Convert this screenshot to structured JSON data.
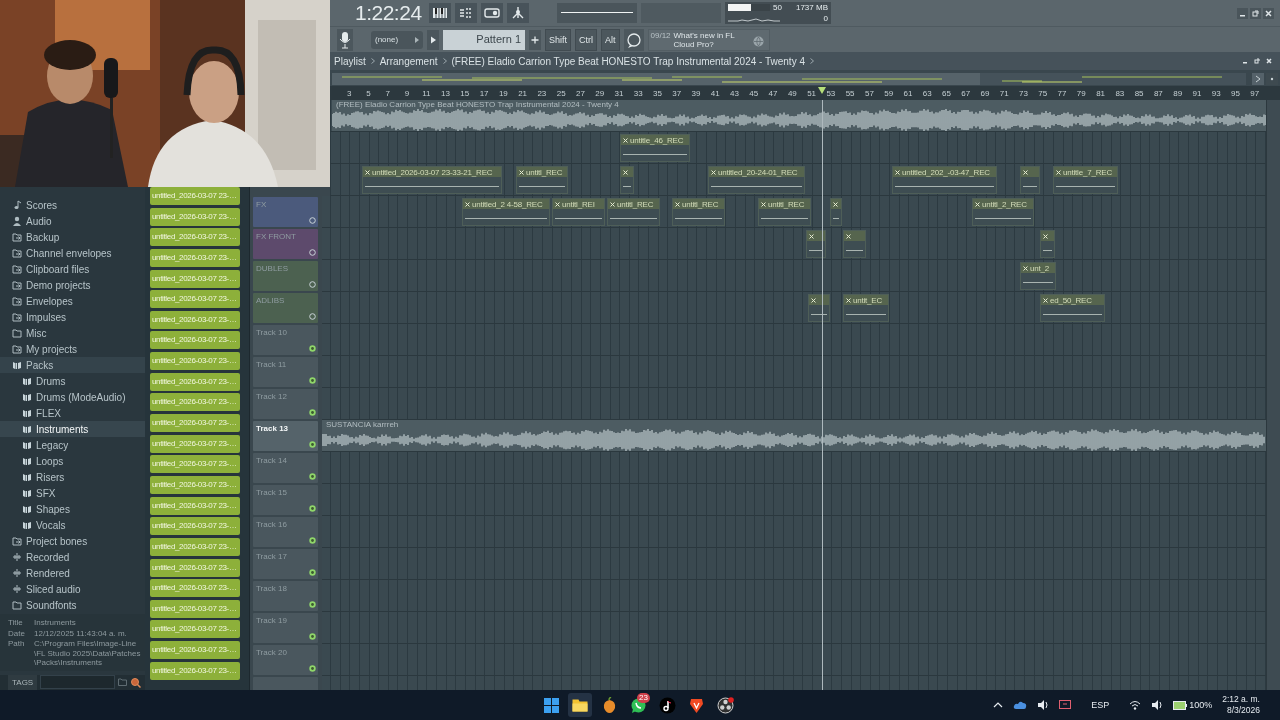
{
  "toolbar": {
    "time": "1:22:24",
    "pattern_mode": "(none)",
    "pattern": "Pattern 1",
    "modifier_keys": [
      "Shift",
      "Ctrl",
      "Alt"
    ],
    "hint_counter": "09/12",
    "hint": "What's new in FL Cloud Pro?",
    "cpu_meter": {
      "level": 0.55
    },
    "cpu": "50",
    "memory": "1737 MB",
    "polyphony": "0"
  },
  "browser": {
    "items": [
      {
        "label": "Scores",
        "kind": "note",
        "selected": false
      },
      {
        "label": "Audio",
        "kind": "person",
        "selected": false
      },
      {
        "label": "Backup",
        "kind": "link",
        "selected": false
      },
      {
        "label": "Channel envelopes",
        "kind": "link",
        "selected": false
      },
      {
        "label": "Clipboard files",
        "kind": "link",
        "selected": false
      },
      {
        "label": "Demo projects",
        "kind": "link",
        "selected": false
      },
      {
        "label": "Envelopes",
        "kind": "link",
        "selected": false
      },
      {
        "label": "Impulses",
        "kind": "link",
        "selected": false
      },
      {
        "label": "Misc",
        "kind": "folder",
        "selected": false
      },
      {
        "label": "My projects",
        "kind": "link",
        "selected": false
      },
      {
        "label": "Packs",
        "kind": "pack",
        "selected": false,
        "expanded": true,
        "children": [
          {
            "label": "Drums",
            "kind": "pack",
            "selected": false
          },
          {
            "label": "Drums (ModeAudio)",
            "kind": "pack",
            "selected": false
          },
          {
            "label": "FLEX",
            "kind": "pack",
            "selected": false
          },
          {
            "label": "Instruments",
            "kind": "pack",
            "selected": true
          },
          {
            "label": "Legacy",
            "kind": "pack",
            "selected": false
          },
          {
            "label": "Loops",
            "kind": "pack",
            "selected": false
          },
          {
            "label": "Risers",
            "kind": "pack",
            "selected": false
          },
          {
            "label": "SFX",
            "kind": "pack",
            "selected": false
          },
          {
            "label": "Shapes",
            "kind": "pack",
            "selected": false
          },
          {
            "label": "Vocals",
            "kind": "pack",
            "selected": false
          }
        ]
      },
      {
        "label": "Project bones",
        "kind": "link",
        "selected": false
      },
      {
        "label": "Recorded",
        "kind": "wave",
        "selected": false
      },
      {
        "label": "Rendered",
        "kind": "wave",
        "selected": false
      },
      {
        "label": "Sliced audio",
        "kind": "wave",
        "selected": false
      },
      {
        "label": "Soundfonts",
        "kind": "folder",
        "selected": false
      }
    ],
    "info": [
      {
        "label": "Title",
        "value": "Instruments"
      },
      {
        "label": "Date",
        "value": "12/12/2025 11:43:04 a. m."
      },
      {
        "label": "Path",
        "value": "C:\\Program Files\\Image-Line\\FL Studio 2025\\Data\\Patches\\Packs\\Instruments"
      }
    ],
    "tags_label": "TAGS"
  },
  "picker": {
    "clips": [
      "untitled_2026-03-07 23-…",
      "untitled_2026-03-07 23-…",
      "untitled_2026-03-07 23-…",
      "untitled_2026-03-07 23-…",
      "untitled_2026-03-07 23-…",
      "untitled_2026-03-07 23-…",
      "untitled_2026-03-07 23-…",
      "untitled_2026-03-07 23-…",
      "untitled_2026-03-07 23-…",
      "untitled_2026-03-07 23-…",
      "untitled_2026-03-07 23-…",
      "untitled_2026-03-07 23-…",
      "untitled_2026-03-07 23-…",
      "untitled_2026-03-07 23-…",
      "untitled_2026-03-07 23-…",
      "untitled_2026-03-07 23-…",
      "untitled_2026-03-07 23-…",
      "untitled_2026-03-07 23-…",
      "untitled_2026-03-07 23-…",
      "untitled_2026-03-07 23-…",
      "untitled_2026-03-07 23-…",
      "untitled_2026-03-07 23-…",
      "untitled_2026-03-07 23-…",
      "untitled_2026-03-07 23-…"
    ]
  },
  "playlist": {
    "title": "Playlist",
    "crumbs": [
      "Arrangement",
      "(FREE) Eladio Carrion Type Beat  HONESTO  Trap Instrumental 2024 - Twenty 4"
    ],
    "song_position": {
      "level": 0.53
    },
    "ruler": [
      "3",
      "5",
      "7",
      "9",
      "11",
      "13",
      "15",
      "17",
      "19",
      "21",
      "23",
      "25",
      "27",
      "29",
      "31",
      "33",
      "35",
      "37",
      "39",
      "41",
      "43",
      "45",
      "47",
      "49",
      "51",
      "53",
      "55",
      "57",
      "59",
      "61",
      "63",
      "65",
      "67",
      "69",
      "71",
      "73",
      "75",
      "77",
      "79",
      "81",
      "83",
      "85",
      "87",
      "89",
      "91",
      "93",
      "95",
      "97"
    ],
    "tracks": [
      {
        "clips": [
          {
            "kind": "waveform",
            "label": "(FREE) Eladio Carrion Type Beat  HONESTO  Trap Instrumental 2024 - Twenty 4"
          }
        ]
      },
      {
        "clips": [
          {
            "kind": "recording",
            "label": "untitle_46_REC"
          }
        ]
      },
      {
        "clips": [
          {
            "kind": "recording",
            "label": "untitled_2026-03-07 23-33-21_REC"
          },
          {
            "kind": "recording",
            "label": "untitl_REC"
          },
          {
            "kind": "recording"
          },
          {
            "kind": "recording",
            "label": "untitled_20-24-01_REC"
          },
          {
            "kind": "recording",
            "label": "untitled_202_-03-47_REC"
          },
          {
            "kind": "recording"
          },
          {
            "kind": "recording",
            "label": "untitle_7_REC"
          }
        ]
      },
      {
        "name": "FX",
        "color": "#4b5a7c",
        "selected": false,
        "clips": [
          {
            "kind": "recording",
            "label": "untitled_2 4-58_REC"
          },
          {
            "kind": "recording",
            "label": "untitl_REI"
          },
          {
            "kind": "recording",
            "label": "untitl_REC"
          },
          {
            "kind": "recording",
            "label": "untitl_REC"
          },
          {
            "kind": "recording",
            "label": "untitl_REC"
          },
          {
            "kind": "recording"
          },
          {
            "kind": "recording",
            "label": "untitl_2_REC"
          }
        ]
      },
      {
        "name": "FX FRONT",
        "color": "#5d4a6c",
        "selected": false,
        "clips": [
          {
            "kind": "recording"
          },
          {
            "kind": "recording"
          },
          {
            "kind": "recording"
          }
        ]
      },
      {
        "name": "DUBLES",
        "color": "#4c6150",
        "selected": false,
        "clips": [
          {
            "kind": "recording",
            "label": "unt_2"
          }
        ]
      },
      {
        "name": "ADLIBS",
        "color": "#4c6150",
        "selected": false,
        "clips": [
          {
            "kind": "recording"
          },
          {
            "kind": "recording",
            "label": "untit_EC"
          },
          {
            "kind": "recording",
            "label": "ed_50_REC"
          }
        ]
      },
      {
        "name": "Track 10",
        "selected": false
      },
      {
        "name": "Track 11",
        "selected": false
      },
      {
        "name": "Track 12",
        "selected": false
      },
      {
        "name": "Track 13",
        "selected": true,
        "clips": [
          {
            "kind": "waveform",
            "label": "SUSTANCIA karrreh"
          }
        ]
      },
      {
        "name": "Track 14",
        "selected": false
      },
      {
        "name": "Track 15",
        "selected": false
      },
      {
        "name": "Track 16",
        "selected": false
      },
      {
        "name": "Track 17",
        "selected": false
      },
      {
        "name": "Track 18",
        "selected": false
      },
      {
        "name": "Track 19",
        "selected": false
      },
      {
        "name": "Track 20",
        "selected": false
      }
    ]
  },
  "taskbar": {
    "badge": "23",
    "language": "ESP",
    "battery": "100%",
    "time": "2:12 a. m.",
    "date": "8/3/2026"
  }
}
